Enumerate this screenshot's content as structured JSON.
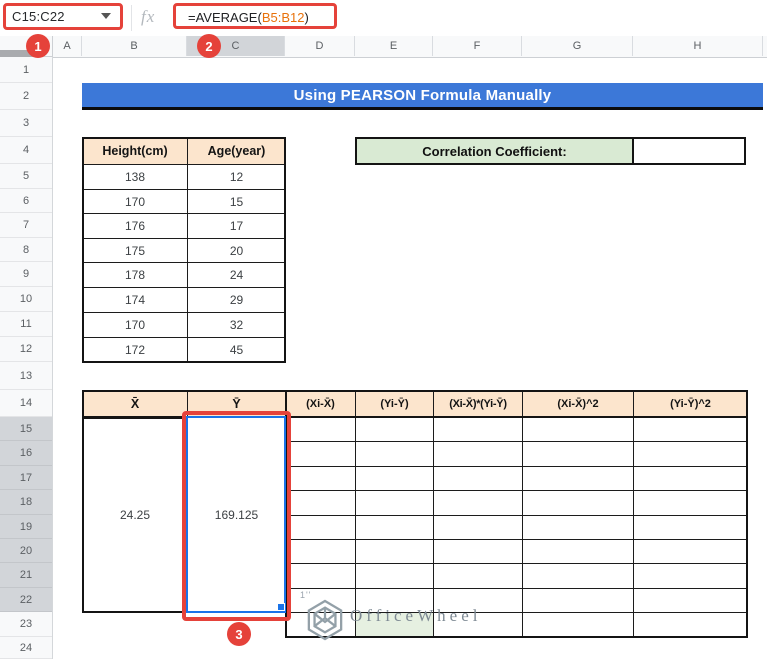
{
  "formula_bar": {
    "name_box_value": "C15:C22",
    "fx_label": "fx",
    "formula": {
      "prefix": "=AVERAGE(",
      "range": "B5:B12",
      "suffix": ")"
    }
  },
  "annotations": {
    "step1_label": "1",
    "step2_label": "2",
    "step3_label": "3"
  },
  "colors": {
    "annotation_red": "#e5423a",
    "selection_blue": "#1a73e8",
    "banner_blue": "#3c78d8",
    "header_tan": "#fce5cd",
    "label_green": "#d9ead3",
    "range_orange": "#e8710a"
  },
  "grid": {
    "column_headers": [
      "A",
      "B",
      "C",
      "D",
      "E",
      "F",
      "G",
      "H"
    ],
    "row_headers": [
      "1",
      "2",
      "3",
      "4",
      "5",
      "6",
      "7",
      "8",
      "9",
      "10",
      "11",
      "12",
      "13",
      "14",
      "15",
      "16",
      "17",
      "18",
      "19",
      "20",
      "21",
      "22",
      "23",
      "24"
    ],
    "selected_column": "C",
    "selected_row_start": 15,
    "selected_row_end": 22
  },
  "title_banner": {
    "text": "Using PEARSON Formula Manually"
  },
  "height_age_table": {
    "headers": [
      "Height(cm)",
      "Age(year)"
    ],
    "rows": [
      [
        "138",
        "12"
      ],
      [
        "170",
        "15"
      ],
      [
        "176",
        "17"
      ],
      [
        "175",
        "20"
      ],
      [
        "178",
        "24"
      ],
      [
        "174",
        "29"
      ],
      [
        "170",
        "32"
      ],
      [
        "172",
        "45"
      ]
    ]
  },
  "correlation": {
    "label": "Correlation Coefficient:",
    "value": ""
  },
  "calc_table": {
    "headers": [
      "X̄",
      "Ȳ",
      "(Xi-X̄)",
      "(Yi-Ȳ)",
      "(Xi-X̄)*(Yi-Ȳ)",
      "(Xi-X̄)^2",
      "(Yi-Ȳ)^2"
    ],
    "x_mean": "24.25",
    "y_mean": "169.125"
  },
  "watermark": {
    "prefix_mark": "1''",
    "text": "OfficeWheel"
  }
}
